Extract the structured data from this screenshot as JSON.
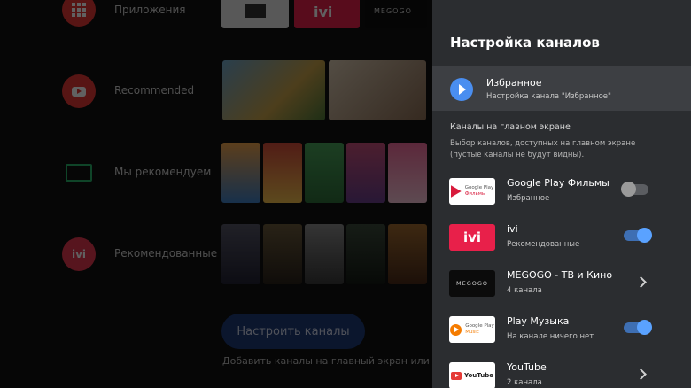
{
  "launcher": {
    "rows": [
      {
        "label": "Приложения",
        "icon": "apps-grid-icon",
        "color": "#e53935"
      },
      {
        "label": "Recommended",
        "icon": "youtube-icon",
        "color": "#e53935"
      },
      {
        "label": "Мы рекомендуем",
        "icon": "megogo-icon",
        "color": "#29b36b"
      },
      {
        "label": "Рекомендованные",
        "icon": "ivi-icon",
        "color": "#e53950"
      }
    ],
    "customize_button": "Настроить каналы",
    "hint": "Добавить каналы на главный экран или уда"
  },
  "panel": {
    "title": "Настройка каналов",
    "favorites": {
      "title": "Избранное",
      "subtitle": "Настройка канала \"Избранное\""
    },
    "section_title": "Каналы на главном экране",
    "section_desc": "Выбор каналов, доступных на главном экране (пустые каналы не будут видны).",
    "channels": [
      {
        "name": "Google Play Фильмы",
        "sub": "Избранное",
        "control": "toggle",
        "on": false,
        "logo_line1": "Google Play",
        "logo_line2": "Фильмы"
      },
      {
        "name": "ivi",
        "sub": "Рекомендованные",
        "control": "toggle",
        "on": true,
        "logo_text": "ivi"
      },
      {
        "name": "MEGOGO - ТВ и Кино",
        "sub": "4 канала",
        "control": "chevron",
        "logo_text": "MEGOGO"
      },
      {
        "name": "Play Музыка",
        "sub": "На канале ничего нет",
        "control": "toggle",
        "on": true,
        "logo_line1": "Google Play",
        "logo_line2": "Music"
      },
      {
        "name": "YouTube",
        "sub": "2 канала",
        "control": "chevron",
        "logo_text": "YouTube"
      }
    ]
  },
  "colors": {
    "panel_bg": "#2b2d30",
    "accent_blue": "#4a8ef0",
    "ivi_red": "#e8204a"
  }
}
